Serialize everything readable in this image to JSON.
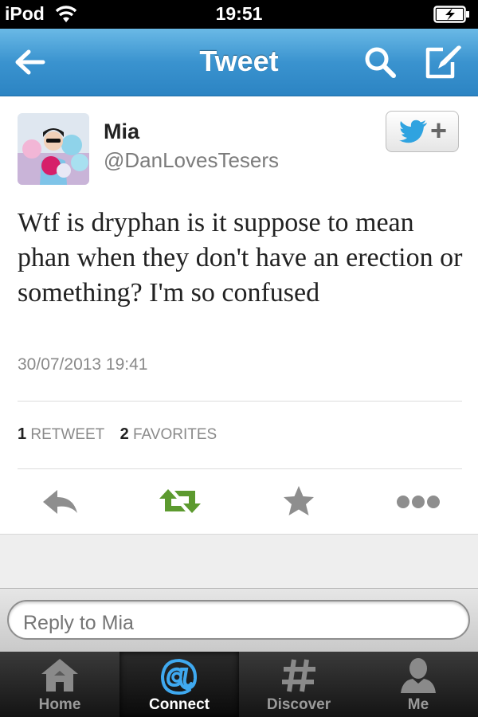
{
  "status_bar": {
    "carrier": "iPod",
    "time": "19:51",
    "wifi_icon": "wifi-icon",
    "battery_icon": "battery-charging-icon"
  },
  "nav": {
    "title": "Tweet",
    "back_icon": "back-arrow-icon",
    "search_icon": "search-icon",
    "compose_icon": "compose-icon"
  },
  "tweet": {
    "author_name": "Mia",
    "author_handle": "@DanLovesTesers",
    "text": "Wtf is dryphan is it suppose to mean phan when they don't have an erection or something? I'm so confused",
    "timestamp": "30/07/2013 19:41",
    "retweet_count": "1",
    "retweet_label": "RETWEET",
    "favorite_count": "2",
    "favorite_label": "FAVORITES",
    "follow_icon": "twitter-bird-plus-icon"
  },
  "actions": [
    {
      "name": "reply",
      "icon": "reply-icon"
    },
    {
      "name": "retweet",
      "icon": "retweet-icon"
    },
    {
      "name": "favorite",
      "icon": "star-icon"
    },
    {
      "name": "more",
      "icon": "more-icon"
    }
  ],
  "reply": {
    "placeholder": "Reply to Mia"
  },
  "tabs": [
    {
      "label": "Home",
      "icon": "home-icon",
      "active": false
    },
    {
      "label": "Connect",
      "icon": "at-icon",
      "active": true
    },
    {
      "label": "Discover",
      "icon": "hashtag-icon",
      "active": false
    },
    {
      "label": "Me",
      "icon": "person-icon",
      "active": false
    }
  ],
  "colors": {
    "nav_blue": "#3a93cf",
    "twitter_blue": "#2fa3e0",
    "retweet_green": "#5c9a2f",
    "tab_bg": "#1e1e1e"
  }
}
